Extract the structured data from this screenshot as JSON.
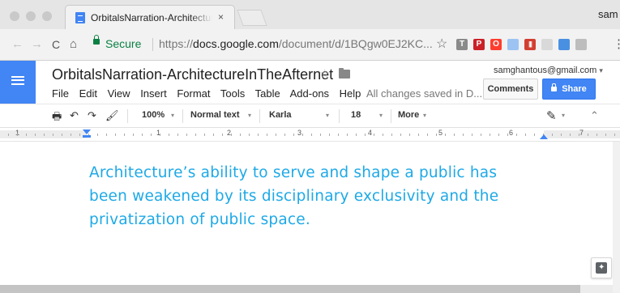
{
  "browser": {
    "tab_title": "OrbitalsNarration-Architecture",
    "tab_close": "×",
    "profile_name": "sam",
    "secure_label": "Secure",
    "url_scheme": "https://",
    "url_host": "docs.google.com",
    "url_path": "/document/d/1BQgw0EJ2KC...",
    "nav": {
      "back": "←",
      "forward": "→",
      "reload": "C",
      "home": "⌂"
    },
    "star": "☆",
    "extensions": [
      {
        "name": "text-extension-icon",
        "glyph": "T",
        "color": "#8a8a8a"
      },
      {
        "name": "pinterest-extension-icon",
        "glyph": "P",
        "color": "#cb2027"
      },
      {
        "name": "opera-extension-icon",
        "glyph": "O",
        "color": "#ff3d2e"
      },
      {
        "name": "docs-extension-icon",
        "glyph": "",
        "color": "#9dc3f3"
      },
      {
        "name": "bars-extension-icon",
        "glyph": "|||",
        "color": "#d23f31"
      },
      {
        "name": "cloud-extension-icon",
        "glyph": "",
        "color": "#d9d9d9"
      },
      {
        "name": "photo-extension-icon",
        "glyph": "",
        "color": "#4a90e2"
      },
      {
        "name": "camera-extension-icon",
        "glyph": "",
        "color": "#bdbdbd"
      }
    ],
    "menu": "⋮"
  },
  "docs": {
    "title": "OrbitalsNarration-ArchitectureInTheAfternet",
    "title_star": "☆",
    "menus": [
      "File",
      "Edit",
      "View",
      "Insert",
      "Format",
      "Tools",
      "Table",
      "Add-ons",
      "Help"
    ],
    "save_status": "All changes saved in D...",
    "account": "samghantous@gmail.com",
    "account_caret": "▾",
    "comments_label": "Comments",
    "share_label": "Share"
  },
  "toolbar": {
    "print": "🖶",
    "undo": "↶",
    "redo": "↷",
    "paint_format": "🖌",
    "zoom": "100%",
    "style": "Normal text",
    "font": "Karla",
    "font_size": "18",
    "more": "More",
    "caret": "▾",
    "pen": "✎",
    "collapse": "⌃"
  },
  "ruler": {
    "numbers": [
      "1",
      "1",
      "2",
      "3",
      "4",
      "5",
      "6",
      "7"
    ]
  },
  "document": {
    "lines": [
      "Architecture’s ability to serve and shape a public has",
      "been weakened by its disciplinary exclusivity and the",
      "privatization of public space."
    ],
    "text_color": "#1ea9e6"
  }
}
